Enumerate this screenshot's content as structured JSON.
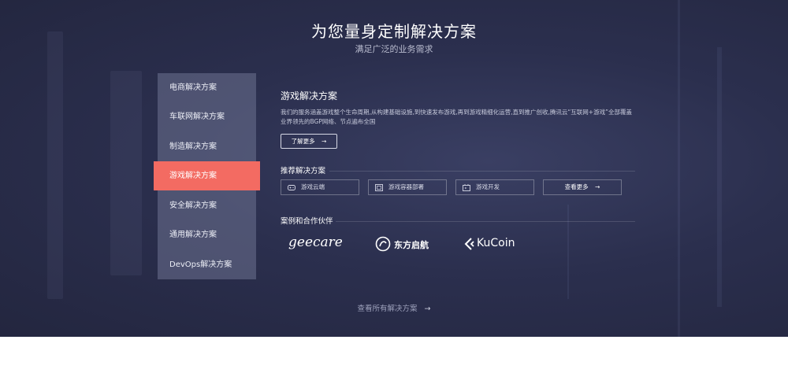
{
  "hero": {
    "title": "为您量身定制解决方案",
    "subtitle": "满足广泛的业务需求"
  },
  "menu": {
    "items": [
      {
        "label": "电商解决方案",
        "active": false
      },
      {
        "label": "车联网解决方案",
        "active": false
      },
      {
        "label": "制造解决方案",
        "active": false
      },
      {
        "label": "游戏解决方案",
        "active": true
      },
      {
        "label": "安全解决方案",
        "active": false
      },
      {
        "label": "通用解决方案",
        "active": false
      },
      {
        "label": "DevOps解决方案",
        "active": false
      }
    ]
  },
  "solution": {
    "title": "游戏解决方案",
    "description": "我们的服务涵盖游戏整个生命周期,从构建基础设施,到快速发布游戏,再到游戏精细化运营,直到推广创收,腾讯云“互联网+游戏”全部覆盖业界领先的BGP网络、节点遍布全国",
    "learn_more": "了解更多",
    "arrow": "→"
  },
  "recommended": {
    "title": "推荐解决方案",
    "items": [
      {
        "label": "游戏云端",
        "icon": "gamepad-icon"
      },
      {
        "label": "游戏容器部署",
        "icon": "container-icon"
      },
      {
        "label": "游戏开发",
        "icon": "dev-icon"
      }
    ],
    "more": "查看更多",
    "arrow": "→"
  },
  "cases": {
    "title": "案例和合作伙伴",
    "logos": [
      {
        "text": "geecare",
        "icon": "geecare-logo"
      },
      {
        "text": "东方启航",
        "icon": "dongfangqihang-logo"
      },
      {
        "text": "KuCoin",
        "icon": "kucoin-logo"
      }
    ]
  },
  "footer": {
    "view_all": "查看所有解决方案",
    "arrow": "→"
  },
  "colors": {
    "active": "#f36b62",
    "background": "#2b2f4e"
  }
}
